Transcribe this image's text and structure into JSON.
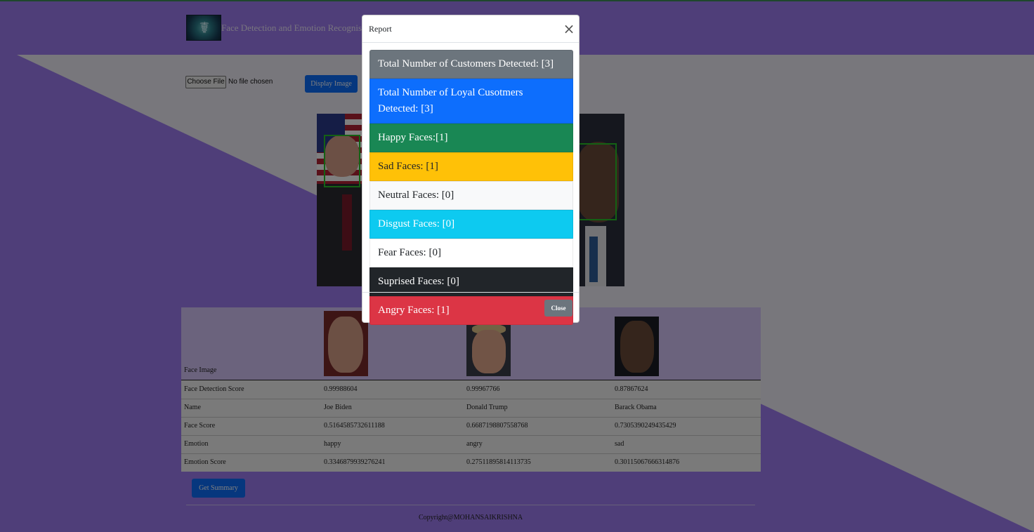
{
  "header": {
    "app_title": "Face Detection and Emotion Recognisation",
    "logo_icon": "medical-caduceus-logo"
  },
  "upload": {
    "choose_file_label": "Choose File",
    "file_status": "No file chosen",
    "display_button": "Display Image"
  },
  "results_table": {
    "header_label": "Face Image",
    "faces": [
      {
        "alt": "Joe Biden"
      },
      {
        "alt": "Donald Trump"
      },
      {
        "alt": "Barack Obama"
      }
    ],
    "rows": [
      {
        "label": "Face Detection Score",
        "values": [
          "0.99988604",
          "0.99967766",
          "0.87867624"
        ]
      },
      {
        "label": "Name",
        "values": [
          "Joe Biden",
          "Donald Trump",
          "Barack Obama"
        ]
      },
      {
        "label": "Face Score",
        "values": [
          "0.5164585732611188",
          "0.6687198807558768",
          "0.7305390249435429"
        ]
      },
      {
        "label": "Emotion",
        "values": [
          "happy",
          "angry",
          "sad"
        ]
      },
      {
        "label": "Emotion Score",
        "values": [
          "0.3346879939276241",
          "0.27511895814113735",
          "0.30115067666314876"
        ]
      }
    ]
  },
  "summary_button": "Get Summary",
  "footer": {
    "copyright": "Copyright@MOHANSAIKRISHNA"
  },
  "modal": {
    "title": "Report",
    "close_icon": "close-x-icon",
    "items": [
      {
        "text": "Total Number of Customers Detected: [3]",
        "bg": "#6c757d",
        "fg": "#ffffff"
      },
      {
        "text": "Total Number of Loyal Cusotmers Detected: [3]",
        "bg": "#0d6efd",
        "fg": "#ffffff"
      },
      {
        "text": "Happy Faces:[1]",
        "bg": "#198754",
        "fg": "#ffffff"
      },
      {
        "text": "Sad Faces: [1]",
        "bg": "#ffc107",
        "fg": "#212529"
      },
      {
        "text": "Neutral Faces: [0]",
        "bg": "#f8f9fa",
        "fg": "#212529"
      },
      {
        "text": "Disgust Faces: [0]",
        "bg": "#0dcaf0",
        "fg": "#ffffff"
      },
      {
        "text": "Fear Faces: [0]",
        "bg": "#ffffff",
        "fg": "#212529"
      },
      {
        "text": "Suprised Faces: [0]",
        "bg": "#212529",
        "fg": "#ffffff"
      },
      {
        "text": "Angry Faces: [1]",
        "bg": "#dc3545",
        "fg": "#ffffff"
      }
    ],
    "close_button": "Close"
  },
  "colors": {
    "page_purple": "#9f7cf2",
    "diagonal_light": "#f0eef8",
    "primary_blue": "#0d6efd",
    "face_box_green": "#28c228"
  }
}
